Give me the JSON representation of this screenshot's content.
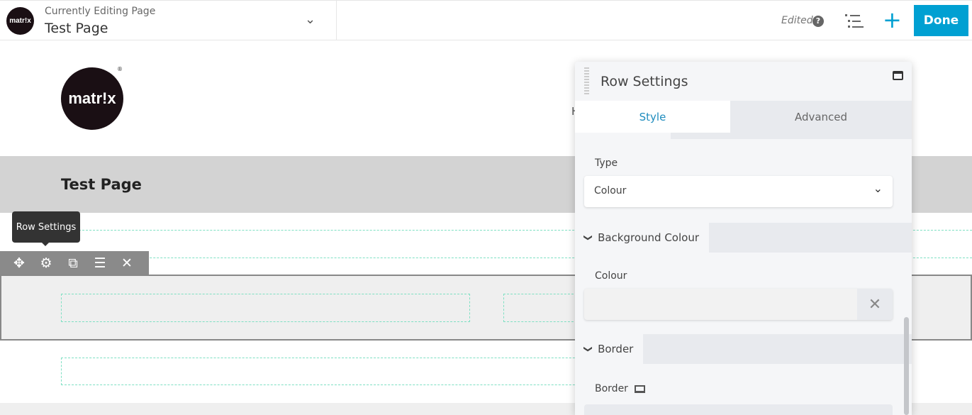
{
  "header": {
    "subtitle": "Currently Editing Page",
    "title": "Test Page",
    "status": "Edited",
    "done_label": "Done",
    "logo_text": "matr!x"
  },
  "page": {
    "logo_text": "matr!x",
    "heading": "Test Page",
    "nav_partial": "H"
  },
  "row_toolbar": {
    "tooltip": "Row Settings",
    "icons": [
      "move-icon",
      "gear-icon",
      "duplicate-icon",
      "menu-icon",
      "close-icon"
    ]
  },
  "panel": {
    "title": "Row Settings",
    "tabs": [
      {
        "label": "Style",
        "active": true
      },
      {
        "label": "Advanced",
        "active": false
      }
    ],
    "type_label": "Type",
    "type_value": "Colour",
    "bg_section": "Background Colour",
    "colour_label": "Colour",
    "colour_value": "",
    "border_section": "Border",
    "border_label": "Border"
  },
  "colors": {
    "accent": "#00a0d2",
    "done_bg": "#00a0d2"
  }
}
